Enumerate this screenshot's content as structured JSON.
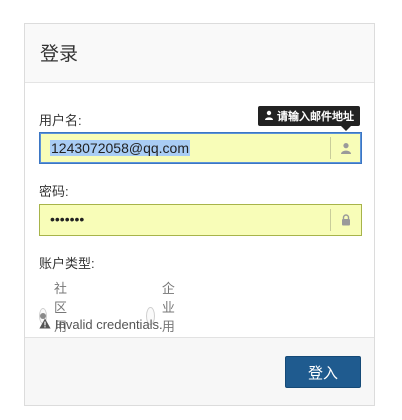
{
  "header": {
    "title": "登录"
  },
  "form": {
    "username_label": "用户名:",
    "username_value": "1243072058@qq.com",
    "username_icon": "user-icon",
    "username_tooltip": "请输入邮件地址",
    "password_label": "密码:",
    "password_value": "•••••••",
    "password_icon": "lock-icon",
    "account_type_label": "账户类型:",
    "account_types": [
      {
        "label": "社区用户",
        "selected": true
      },
      {
        "label": "企业用户",
        "selected": false
      }
    ],
    "error_message": "Invalid credentials.",
    "error_icon": "warning-icon"
  },
  "footer": {
    "login_label": "登入"
  },
  "colors": {
    "field_bg": "#f8fdb8",
    "focus_border": "#3b76c4",
    "button_bg": "#1f5b8f",
    "selection": "#a9cdf5"
  }
}
